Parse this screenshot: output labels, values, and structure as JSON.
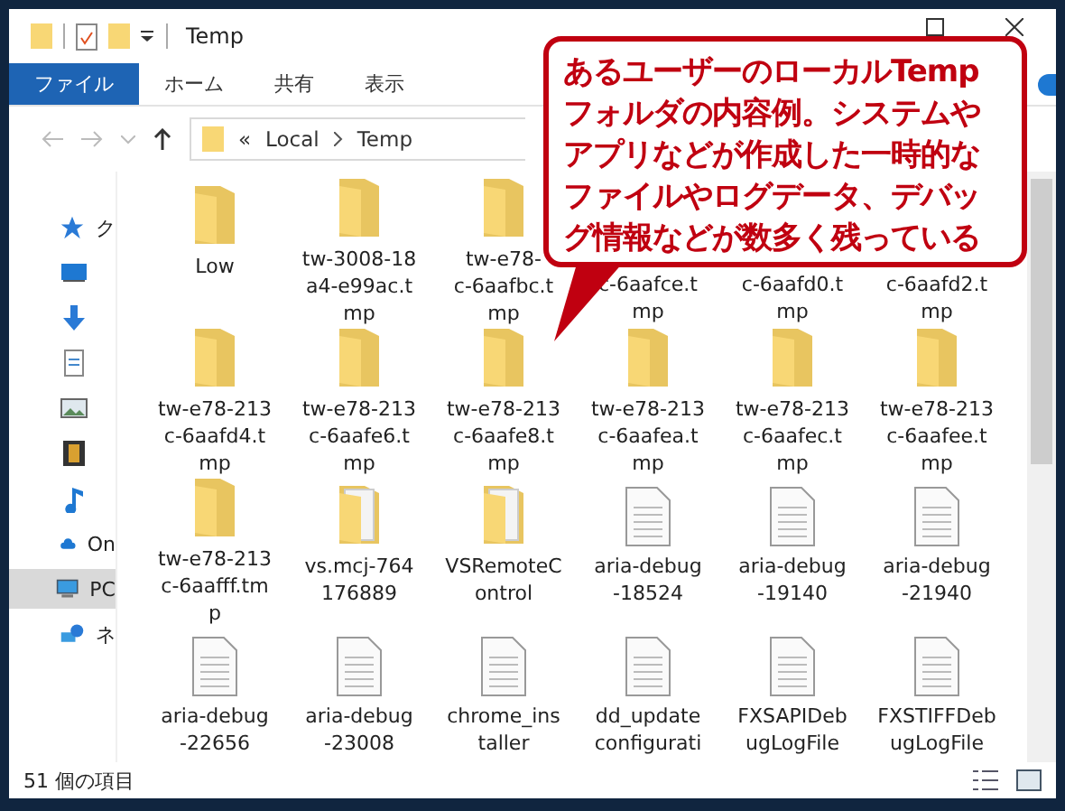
{
  "window": {
    "title": "Temp"
  },
  "ribbon_tabs": [
    {
      "label": "ファイル",
      "selected": true
    },
    {
      "label": "ホーム",
      "selected": false
    },
    {
      "label": "共有",
      "selected": false
    },
    {
      "label": "表示",
      "selected": false
    }
  ],
  "address": {
    "separator": "«",
    "path": [
      "Local",
      "Temp"
    ]
  },
  "sidebar": {
    "items": [
      {
        "kind": "star",
        "label": "ク",
        "selected": false
      },
      {
        "kind": "desktop",
        "selected": false
      },
      {
        "kind": "download",
        "selected": false
      },
      {
        "kind": "document",
        "selected": false
      },
      {
        "kind": "image",
        "selected": false
      },
      {
        "kind": "video",
        "selected": false
      },
      {
        "kind": "music",
        "selected": false
      },
      {
        "kind": "cloud",
        "label": "On",
        "selected": false
      },
      {
        "kind": "pc",
        "label": "PC",
        "selected": true
      },
      {
        "kind": "network",
        "label": "ネ",
        "selected": false
      }
    ]
  },
  "files": [
    {
      "kind": "folder",
      "name": "Low"
    },
    {
      "kind": "folder",
      "name": "tw-3008-18\na4-e99ac.t\nmp"
    },
    {
      "kind": "folder",
      "name": "tw-e78-\nc-6aafbc.t\nmp"
    },
    {
      "kind": "covered",
      "name": "c-6aafce.t\nmp"
    },
    {
      "kind": "covered",
      "name": "c-6aafd0.t\nmp"
    },
    {
      "kind": "covered",
      "name": "c-6aafd2.t\nmp"
    },
    {
      "kind": "folder",
      "name": "tw-e78-213\nc-6aafd4.t\nmp"
    },
    {
      "kind": "folder",
      "name": "tw-e78-213\nc-6aafe6.t\nmp"
    },
    {
      "kind": "folder",
      "name": "tw-e78-213\nc-6aafe8.t\nmp"
    },
    {
      "kind": "folder",
      "name": "tw-e78-213\nc-6aafea.t\nmp"
    },
    {
      "kind": "folder",
      "name": "tw-e78-213\nc-6aafec.t\nmp"
    },
    {
      "kind": "folder",
      "name": "tw-e78-213\nc-6aafee.t\nmp"
    },
    {
      "kind": "folder",
      "name": "tw-e78-213\nc-6aafff.tm\np"
    },
    {
      "kind": "folder-files",
      "name": "vs.mcj-764\n176889"
    },
    {
      "kind": "folder-files",
      "name": "VSRemoteC\nontrol"
    },
    {
      "kind": "file",
      "name": "aria-debug\n-18524"
    },
    {
      "kind": "file",
      "name": "aria-debug\n-19140"
    },
    {
      "kind": "file",
      "name": "aria-debug\n-21940"
    },
    {
      "kind": "file",
      "name": "aria-debug\n-22656"
    },
    {
      "kind": "file",
      "name": "aria-debug\n-23008"
    },
    {
      "kind": "file",
      "name": "chrome_ins\ntaller"
    },
    {
      "kind": "file",
      "name": "dd_update\nconfigurati"
    },
    {
      "kind": "file",
      "name": "FXSAPIDeb\nugLogFile"
    },
    {
      "kind": "file",
      "name": "FXSTIFFDeb\nugLogFile"
    }
  ],
  "status_bar": {
    "count": "51 個の項目"
  },
  "callout": {
    "lines": [
      "あるユーザーのローカルTemp",
      "フォルダの内容例。システムや",
      "アプリなどが作成した一時的な",
      "ファイルやログデータ、デバッ",
      "グ情報などが数多く残っている"
    ]
  }
}
